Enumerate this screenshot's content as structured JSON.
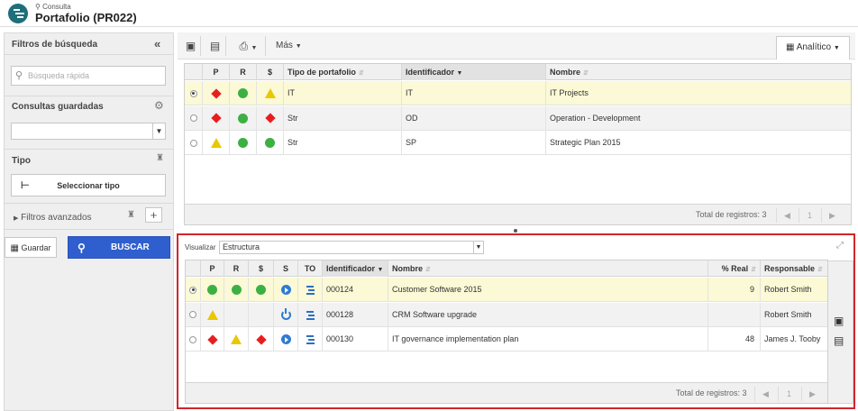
{
  "header": {
    "subtitle": "Consulta",
    "title": "Portafolio (PR022)"
  },
  "sidebar": {
    "filters_title": "Filtros de búsqueda",
    "search_placeholder": "Búsqueda rápida",
    "saved_queries_label": "Consultas guardadas",
    "type_label": "Tipo",
    "select_type_button": "Seleccionar tipo",
    "advanced_filters_label": "Filtros avanzados",
    "save_button": "Guardar",
    "search_button": "BUSCAR"
  },
  "toolbar": {
    "more_label": "Más",
    "view_label": "Analítico"
  },
  "top_grid": {
    "columns": [
      "P",
      "R",
      "$",
      "Tipo de portafolio",
      "Identificador",
      "Nombre"
    ],
    "rows": [
      {
        "p": "red-diamond",
        "r": "green-circle",
        "d": "yellow-triangle",
        "type": "IT",
        "id": "IT",
        "name": "IT Projects",
        "selected": true
      },
      {
        "p": "red-diamond",
        "r": "green-circle",
        "d": "red-diamond",
        "type": "Str",
        "id": "OD",
        "name": "Operation - Development",
        "selected": false
      },
      {
        "p": "yellow-triangle",
        "r": "green-circle",
        "d": "green-circle",
        "type": "Str",
        "id": "SP",
        "name": "Strategic Plan 2015",
        "selected": false
      }
    ],
    "total_label": "Total de registros: 3",
    "page": "1"
  },
  "bottom": {
    "visualize_label": "Visualizar",
    "visualize_value": "Estructura",
    "columns": [
      "P",
      "R",
      "$",
      "S",
      "TO",
      "Identificador",
      "Nombre",
      "% Real",
      "Responsable"
    ],
    "rows": [
      {
        "p": "green-circle",
        "r": "green-circle",
        "d": "green-circle",
        "s": "play",
        "id": "000124",
        "name": "Customer Software 2015",
        "real": "9",
        "resp": "Robert Smith",
        "selected": true
      },
      {
        "p": "yellow-triangle",
        "r": "",
        "d": "",
        "s": "power",
        "id": "000128",
        "name": "CRM Software upgrade",
        "real": "",
        "resp": "Robert Smith",
        "selected": false
      },
      {
        "p": "red-diamond",
        "r": "yellow-triangle",
        "d": "red-diamond",
        "s": "play",
        "id": "000130",
        "name": "IT governance implementation plan",
        "real": "48",
        "resp": "James J. Tooby",
        "selected": false
      }
    ],
    "total_label": "Total de registros: 3",
    "page": "1"
  },
  "colors": {
    "accent": "#2f5fcf",
    "highlight_border": "#d0262a",
    "selected_row": "#fbf9d6",
    "logo": "#1d6f7a"
  }
}
